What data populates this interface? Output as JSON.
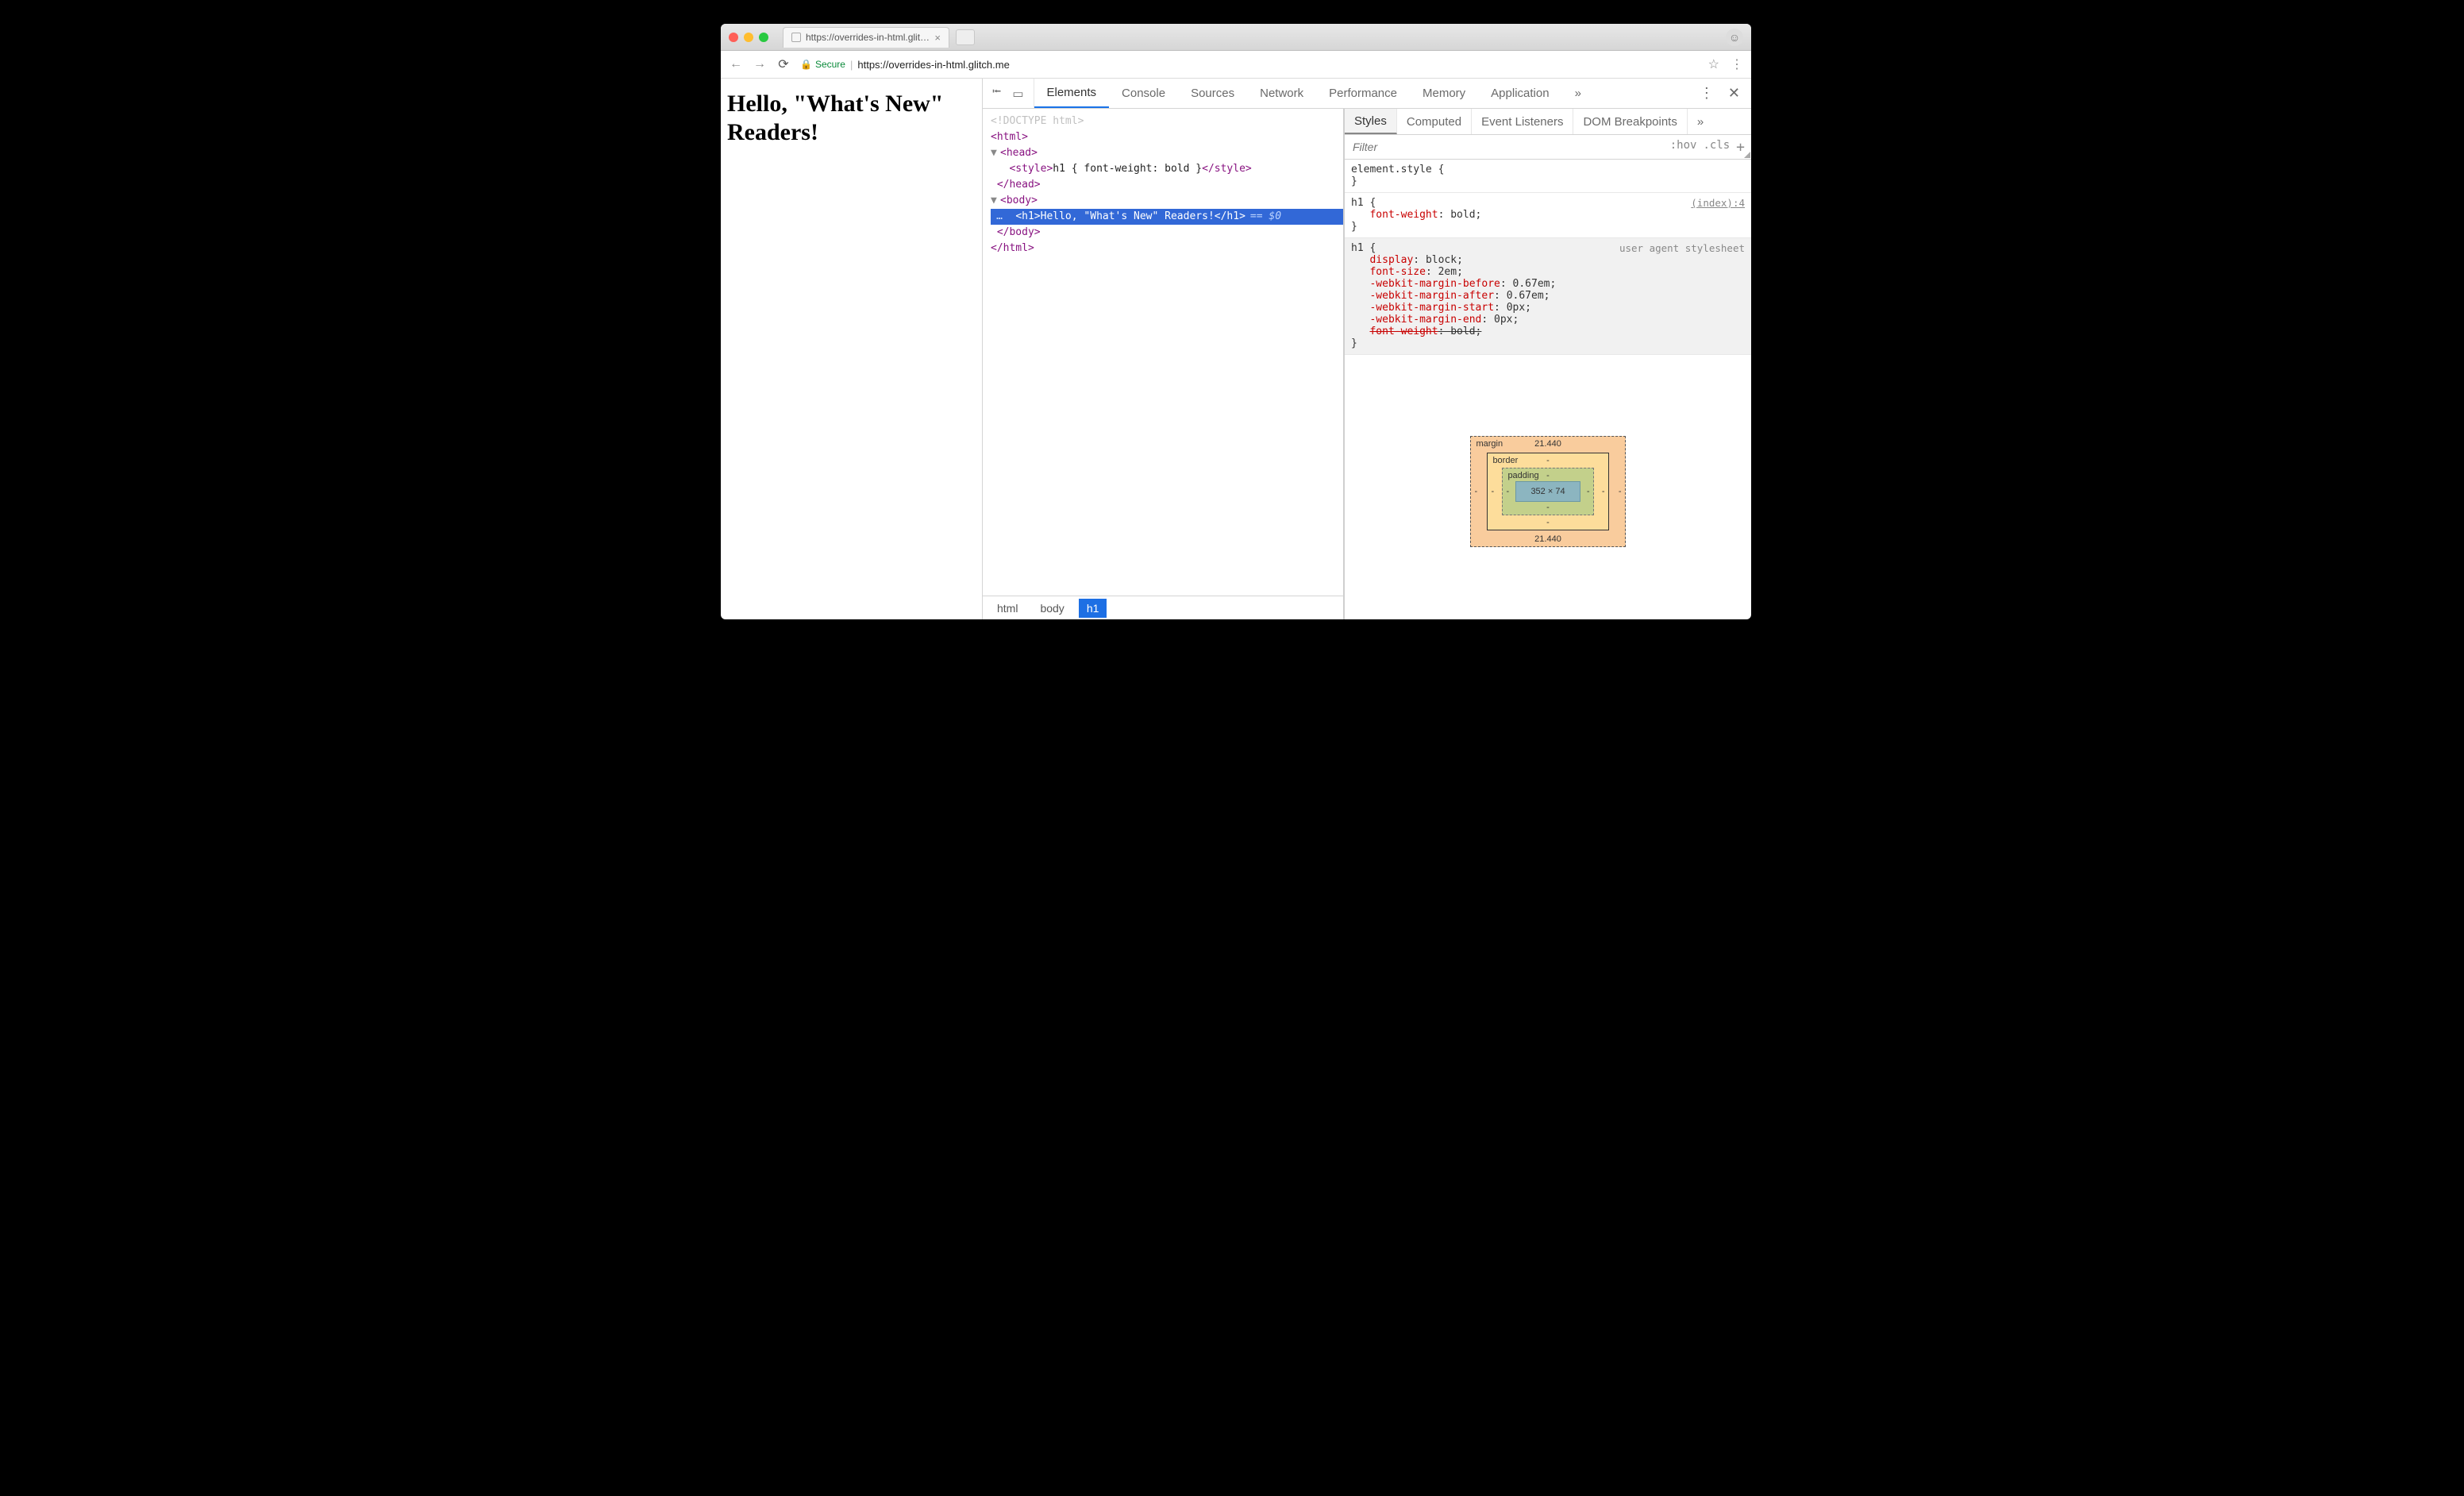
{
  "browser": {
    "tab_title": "https://overrides-in-html.glitch",
    "secure_label": "Secure",
    "url_host": "https://overrides-in-html.glitch.me",
    "star": "☆",
    "menu": "⋮"
  },
  "page": {
    "heading": "Hello, \"What's New\" Readers!"
  },
  "devtools": {
    "tabs": [
      "Elements",
      "Console",
      "Sources",
      "Network",
      "Performance",
      "Memory",
      "Application"
    ],
    "active_tab": "Elements",
    "more": "»",
    "kebab": "⋮",
    "close": "✕"
  },
  "dom": {
    "l0": "<!DOCTYPE html>",
    "l1_open": "<html>",
    "l2_open": "<head>",
    "l3_style_open": "<style>",
    "l3_style_text": "h1 { font-weight: bold }",
    "l3_style_close": "</style>",
    "l2_close": "</head>",
    "l4_open": "<body>",
    "l5_open": "<h1>",
    "l5_text": "Hello, \"What's New\" Readers!",
    "l5_close": "</h1>",
    "l5_var": "== $0",
    "l4_close": "</body>",
    "l1_close": "</html>"
  },
  "breadcrumbs": [
    "html",
    "body",
    "h1"
  ],
  "styles": {
    "tabs": [
      "Styles",
      "Computed",
      "Event Listeners",
      "DOM Breakpoints"
    ],
    "more": "»",
    "filter_placeholder": "Filter",
    "hov": ":hov",
    "cls": ".cls",
    "plus": "+",
    "rules": [
      {
        "selector": "element.style",
        "props": [],
        "source": ""
      },
      {
        "selector": "h1",
        "source": "(index):4",
        "props": [
          {
            "name": "font-weight",
            "value": "bold;"
          }
        ]
      },
      {
        "selector": "h1",
        "source": "user agent stylesheet",
        "gray": true,
        "props": [
          {
            "name": "display",
            "value": "block;"
          },
          {
            "name": "font-size",
            "value": "2em;"
          },
          {
            "name": "-webkit-margin-before",
            "value": "0.67em;"
          },
          {
            "name": "-webkit-margin-after",
            "value": "0.67em;"
          },
          {
            "name": "-webkit-margin-start",
            "value": "0px;"
          },
          {
            "name": "-webkit-margin-end",
            "value": "0px;"
          },
          {
            "name": "font-weight",
            "value": "bold;",
            "strike": true
          }
        ]
      }
    ],
    "boxmodel": {
      "margin_label": "margin",
      "margin_top": "21.440",
      "margin_bottom": "21.440",
      "margin_left": "-",
      "margin_right": "-",
      "border_label": "border",
      "border_v": "-",
      "padding_label": "padding",
      "padding_v": "-",
      "content": "352 × 74"
    }
  }
}
